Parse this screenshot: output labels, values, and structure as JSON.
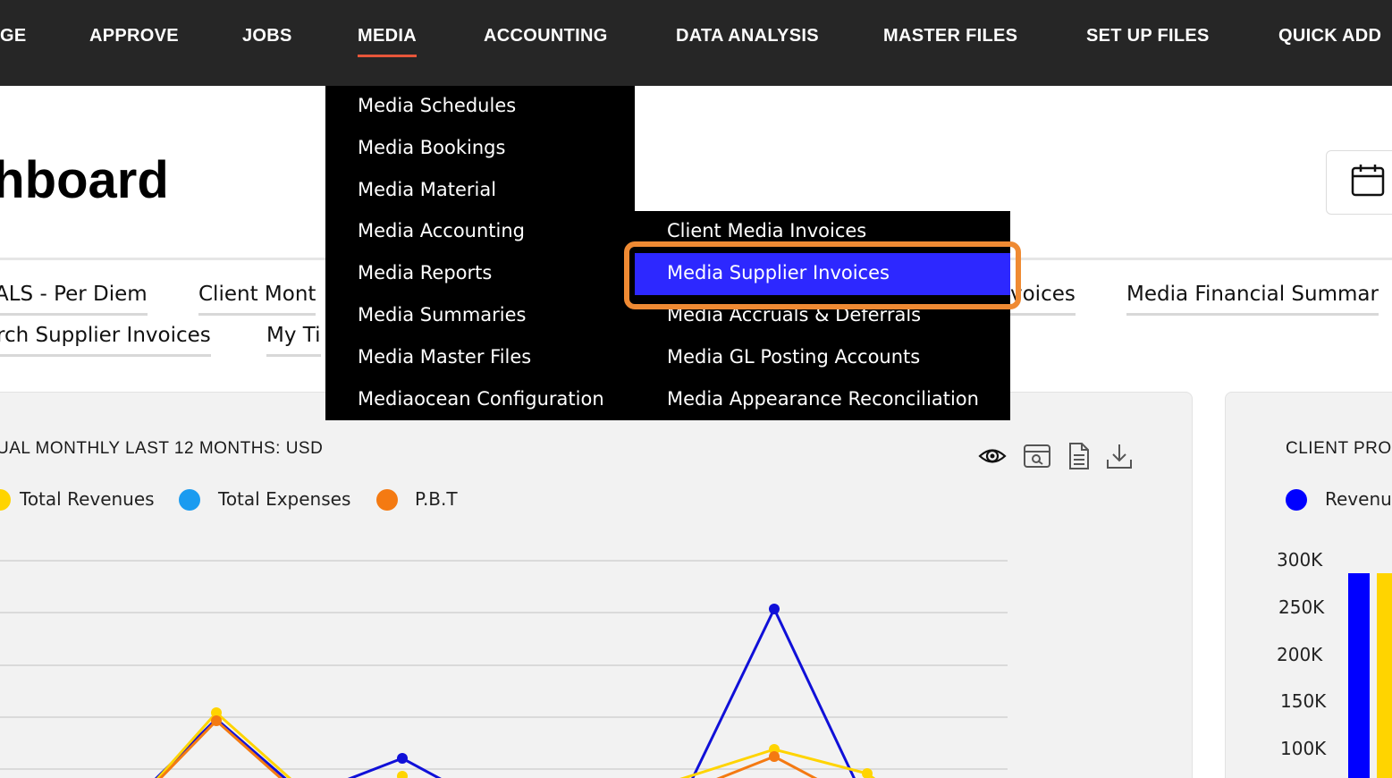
{
  "nav": {
    "items": [
      {
        "label": "GE"
      },
      {
        "label": "APPROVE"
      },
      {
        "label": "JOBS"
      },
      {
        "label": "MEDIA"
      },
      {
        "label": "ACCOUNTING"
      },
      {
        "label": "DATA ANALYSIS"
      },
      {
        "label": "MASTER FILES"
      },
      {
        "label": "SET UP FILES"
      },
      {
        "label": "QUICK ADD"
      }
    ],
    "active": "MEDIA",
    "accent_color": "#e8563a"
  },
  "page": {
    "title": "shboard",
    "calendar_icon": "calendar-icon"
  },
  "report_tabs": [
    {
      "label": "ALS - Per Diem"
    },
    {
      "label": "Client Mont"
    },
    {
      "label": "voices"
    },
    {
      "label": "Media Financial Summar"
    },
    {
      "label": "rch Supplier Invoices"
    },
    {
      "label": "My Ti"
    }
  ],
  "media_menu": {
    "items": [
      {
        "label": "Media Schedules"
      },
      {
        "label": "Media Bookings"
      },
      {
        "label": "Media Material"
      },
      {
        "label": "Media Accounting"
      },
      {
        "label": "Media Reports"
      },
      {
        "label": "Media Summaries"
      },
      {
        "label": "Media Master Files"
      },
      {
        "label": "Mediaocean Configuration"
      }
    ]
  },
  "accounting_submenu": {
    "items": [
      {
        "label": "Client Media Invoices"
      },
      {
        "label": "Media Supplier Invoices"
      },
      {
        "label": "Media Accruals & Deferrals"
      },
      {
        "label": "Media GL Posting Accounts"
      },
      {
        "label": "Media Appearance Reconciliation"
      }
    ],
    "highlighted": "Media Supplier Invoices",
    "highlight_color": "#2d28ff",
    "focus_ring_color": "#ef8a33"
  },
  "main_chart": {
    "title": "UAL MONTHLY LAST 12 MONTHS: USD",
    "legend": [
      {
        "label": "Total Revenues",
        "color": "#ffd400"
      },
      {
        "label": "Total Expenses",
        "color": "#1a9bf0"
      },
      {
        "label": "P.B.T",
        "color": "#f47a12"
      }
    ],
    "toolbar_icons": [
      "eye-icon",
      "search-window-icon",
      "document-icon",
      "download-icon"
    ]
  },
  "side_chart": {
    "title": "CLIENT PRO",
    "legend": [
      {
        "label": "Revenu",
        "color": "#0000ff"
      }
    ],
    "y_ticks": [
      "300K",
      "250K",
      "200K",
      "150K",
      "100K"
    ]
  },
  "chart_data": [
    {
      "type": "line",
      "title": "UAL MONTHLY LAST 12 MONTHS: USD",
      "grid": true,
      "legend_placement": "top-left",
      "series": [
        {
          "name": "Total Revenues",
          "color": "#ffd400"
        },
        {
          "name": "Total Expenses",
          "color": "#1a9bf0"
        },
        {
          "name": "P.B.T",
          "color": "#f47a12"
        }
      ]
    },
    {
      "type": "bar",
      "title": "CLIENT PRO",
      "ylim": [
        0,
        300000
      ],
      "y_tick_labels": [
        "300K",
        "250K",
        "200K",
        "150K",
        "100K"
      ],
      "series": [
        {
          "name": "Revenu",
          "color": "#0000ff",
          "values": [
            285000
          ]
        },
        {
          "color": "#ffd400",
          "values": [
            285000
          ]
        }
      ]
    }
  ]
}
